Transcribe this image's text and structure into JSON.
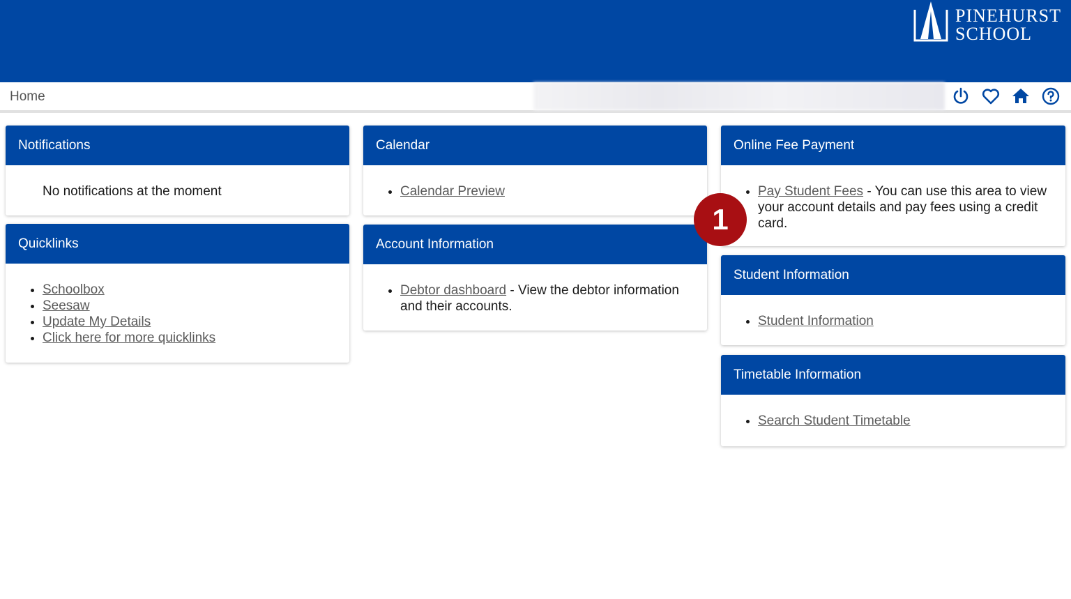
{
  "header": {
    "logo": {
      "line1": "PINEHURST",
      "line2": "SCHOOL"
    },
    "brand_color": "#0047a3"
  },
  "navbar": {
    "breadcrumb": "Home",
    "icons": [
      "power-icon",
      "heart-icon",
      "home-icon",
      "help-icon"
    ]
  },
  "cards": {
    "notifications": {
      "title": "Notifications",
      "message": "No notifications at the moment"
    },
    "quicklinks": {
      "title": "Quicklinks",
      "links": [
        "Schoolbox",
        "Seesaw",
        "Update My Details",
        "Click here for more quicklinks"
      ]
    },
    "calendar": {
      "title": "Calendar",
      "link": "Calendar Preview"
    },
    "account": {
      "title": "Account Information",
      "link": "Debtor dashboard",
      "text": " - View the debtor information and their accounts."
    },
    "fees": {
      "title": "Online Fee Payment",
      "link": "Pay Student Fees",
      "text": " - You can use this area to view your account details and pay fees using a credit card."
    },
    "student": {
      "title": "Student Information",
      "link": "Student Information"
    },
    "timetable": {
      "title": "Timetable Information",
      "link": "Search Student Timetable"
    }
  },
  "annotation": {
    "step": "1",
    "color": "#a80f13"
  }
}
